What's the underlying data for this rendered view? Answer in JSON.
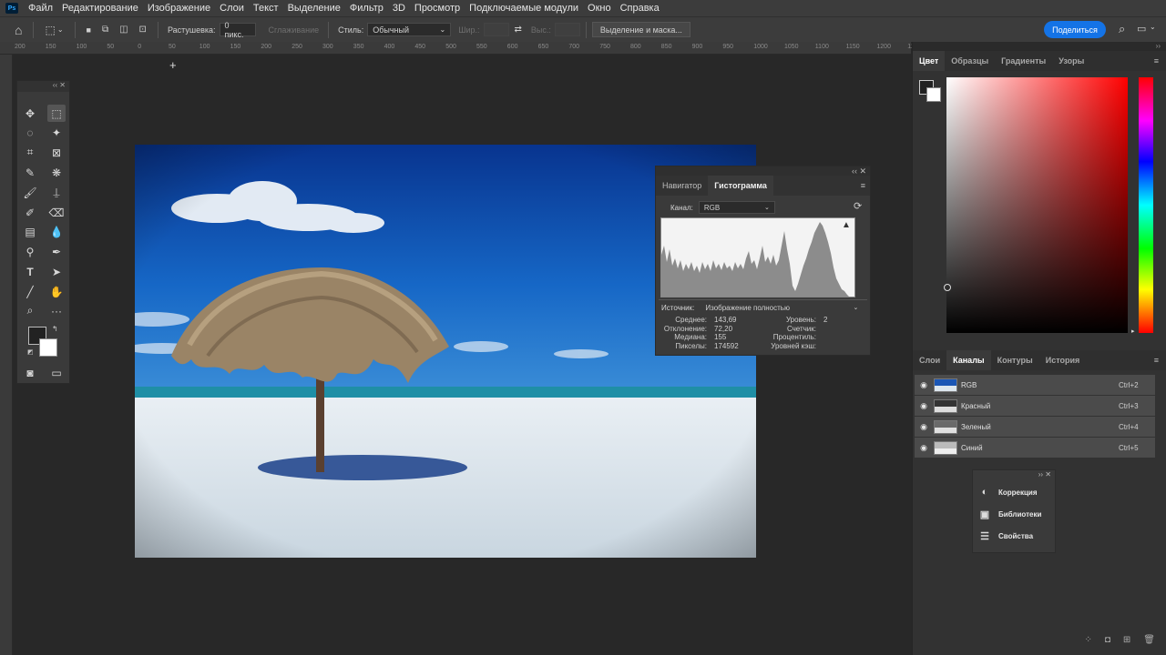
{
  "menubar": {
    "logo": "Ps",
    "items": [
      "Файл",
      "Редактирование",
      "Изображение",
      "Слои",
      "Текст",
      "Выделение",
      "Фильтр",
      "3D",
      "Просмотр",
      "Подключаемые модули",
      "Окно",
      "Справка"
    ]
  },
  "options": {
    "feather_label": "Растушевка:",
    "feather_value": "0 пикс.",
    "antialias_label": "Сглаживание",
    "style_label": "Стиль:",
    "style_value": "Обычный",
    "width_label": "Шир.:",
    "height_label": "Выс.:",
    "select_mask": "Выделение и маска...",
    "share": "Поделиться"
  },
  "ruler": {
    "ticks": [
      "200",
      "150",
      "100",
      "50",
      "0",
      "50",
      "100",
      "150",
      "200",
      "250",
      "300",
      "350",
      "400",
      "450",
      "500",
      "550",
      "600",
      "650",
      "700",
      "750",
      "800",
      "850",
      "900",
      "950",
      "1000",
      "1050",
      "1100",
      "1150",
      "1200",
      "1250"
    ]
  },
  "histogram_panel": {
    "tabs": [
      "Навигатор",
      "Гистограмма"
    ],
    "active_tab": "Гистограмма",
    "channel_label": "Канал:",
    "channel_value": "RGB",
    "source_label": "Источник:",
    "source_value": "Изображение полностью",
    "stats_left_labels": [
      "Среднее:",
      "Отклонение:",
      "Медиана:",
      "Пикселы:"
    ],
    "stats_left_values": [
      "143,69",
      "72,20",
      "155",
      "174592"
    ],
    "stats_right_labels": [
      "Уровень:",
      "Счетчик:",
      "Процентиль:",
      "Уровней кэш:"
    ],
    "stats_right_values": [
      "",
      "",
      "",
      "2"
    ],
    "warning_icon": "warning-icon",
    "refresh_icon": "refresh-icon"
  },
  "color_panel": {
    "tabs": [
      "Цвет",
      "Образцы",
      "Градиенты",
      "Узоры"
    ],
    "active_tab": "Цвет"
  },
  "channels_panel": {
    "tabs": [
      "Слои",
      "Каналы",
      "Контуры",
      "История"
    ],
    "active_tab": "Каналы",
    "rows": [
      {
        "name": "RGB",
        "shortcut": "Ctrl+2"
      },
      {
        "name": "Красный",
        "shortcut": "Ctrl+3"
      },
      {
        "name": "Зеленый",
        "shortcut": "Ctrl+4"
      },
      {
        "name": "Синий",
        "shortcut": "Ctrl+5"
      }
    ]
  },
  "mini_panel": {
    "items": [
      {
        "label": "Коррекция",
        "icon": "adjustments-icon"
      },
      {
        "label": "Библиотеки",
        "icon": "libraries-icon"
      },
      {
        "label": "Свойства",
        "icon": "properties-icon"
      }
    ]
  },
  "colors": {
    "accent": "#1473e6",
    "panel": "#3a3a3a",
    "background": "#282828"
  }
}
